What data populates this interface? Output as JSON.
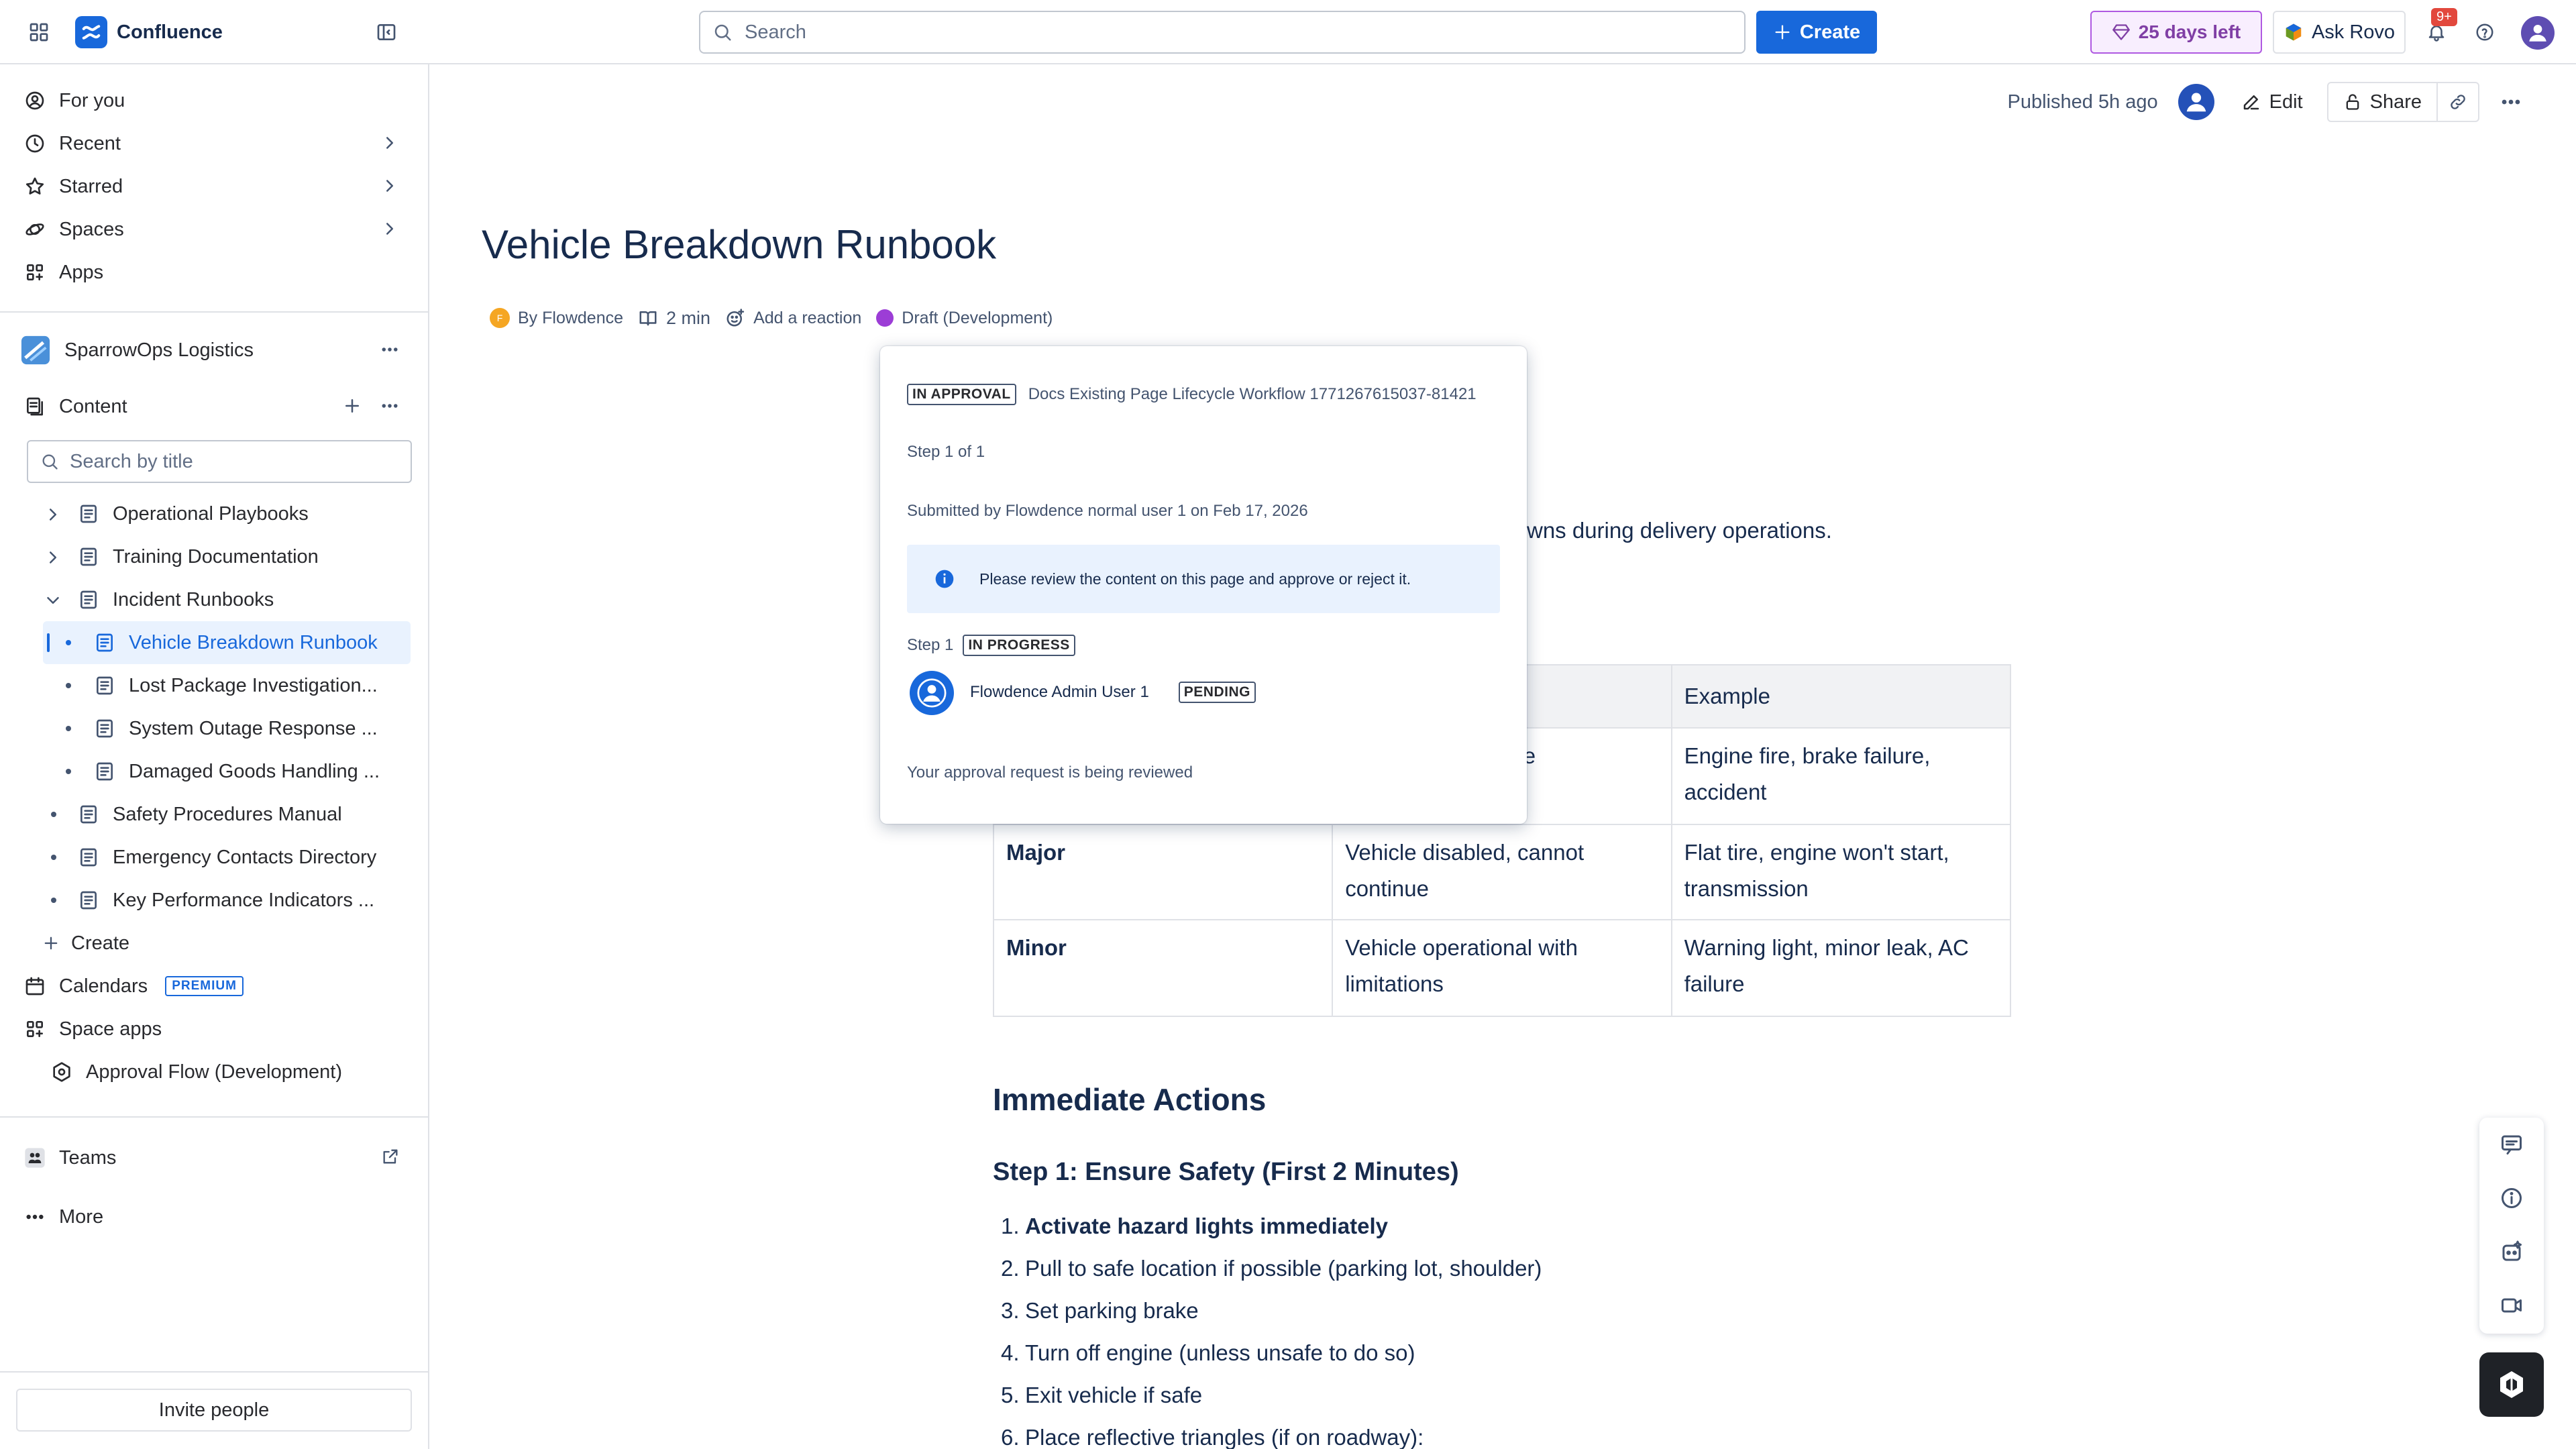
{
  "app": {
    "name": "Confluence"
  },
  "topbar": {
    "search_placeholder": "Search",
    "create_label": "Create",
    "trial_label": "25 days left",
    "ask_rovo_label": "Ask Rovo",
    "notification_badge": "9+"
  },
  "sidebar": {
    "nav": [
      {
        "label": "For you"
      },
      {
        "label": "Recent"
      },
      {
        "label": "Starred"
      },
      {
        "label": "Spaces"
      },
      {
        "label": "Apps"
      }
    ],
    "space_name": "SparrowOps Logistics",
    "content_label": "Content",
    "search_placeholder": "Search by title",
    "tree": [
      {
        "label": "Operational Playbooks"
      },
      {
        "label": "Training Documentation"
      },
      {
        "label": "Incident Runbooks"
      },
      {
        "label": "Vehicle Breakdown Runbook"
      },
      {
        "label": "Lost Package Investigation..."
      },
      {
        "label": "System Outage Response ..."
      },
      {
        "label": "Damaged Goods Handling ..."
      },
      {
        "label": "Safety Procedures Manual"
      },
      {
        "label": "Emergency Contacts Directory"
      },
      {
        "label": "Key Performance Indicators ..."
      }
    ],
    "create_label": "Create",
    "calendars_label": "Calendars",
    "premium_badge": "PREMIUM",
    "space_apps_label": "Space apps",
    "approval_flow_label": "Approval Flow (Development)",
    "teams_label": "Teams",
    "more_label": "More",
    "invite_label": "Invite people"
  },
  "page": {
    "published": "Published 5h ago",
    "edit_label": "Edit",
    "share_label": "Share",
    "title": "Vehicle Breakdown Runbook",
    "author": "By Flowdence",
    "author_initial": "F",
    "read_time": "2 min",
    "reaction_label": "Add a reaction",
    "status": "Draft (Development)",
    "intro_fragment": "wns during delivery operations.",
    "table": {
      "header_col3": "Example",
      "partial_row1_col2": "nicle",
      "row1_col3": "Engine fire, brake failure, accident",
      "rows": [
        {
          "severity": "Major",
          "description": "Vehicle disabled, cannot continue",
          "example": "Flat tire, engine won't start, transmission"
        },
        {
          "severity": "Minor",
          "description": "Vehicle operational with limitations",
          "example": "Warning light, minor leak, AC failure"
        }
      ]
    },
    "heading_immediate": "Immediate Actions",
    "heading_step1": "Step 1: Ensure Safety (First 2 Minutes)",
    "actions": [
      {
        "num": "1.",
        "text": "Activate hazard lights immediately"
      },
      {
        "num": "2.",
        "text": "Pull to safe location if possible (parking lot, shoulder)"
      },
      {
        "num": "3.",
        "text": "Set parking brake"
      },
      {
        "num": "4.",
        "text": "Turn off engine (unless unsafe to do so)"
      },
      {
        "num": "5.",
        "text": "Exit vehicle if safe"
      },
      {
        "num": "6.",
        "text": "Place reflective triangles (if on roadway):"
      }
    ]
  },
  "approval_popup": {
    "status_lozenge": "IN APPROVAL",
    "workflow_name": "Docs Existing Page Lifecycle Workflow 1771267615037-81421",
    "step_count": "Step 1 of 1",
    "submitted": "Submitted by Flowdence normal user 1 on Feb 17, 2026",
    "info_message": "Please review the content on this page and approve or reject it.",
    "step_label": "Step 1",
    "step_status": "IN PROGRESS",
    "approver_name": "Flowdence Admin User 1",
    "approver_status": "PENDING",
    "footer": "Your approval request is being reviewed"
  },
  "colors": {
    "accent": "#1868db",
    "trial": "#803fa5",
    "draft_dot": "#9c3dd6"
  }
}
